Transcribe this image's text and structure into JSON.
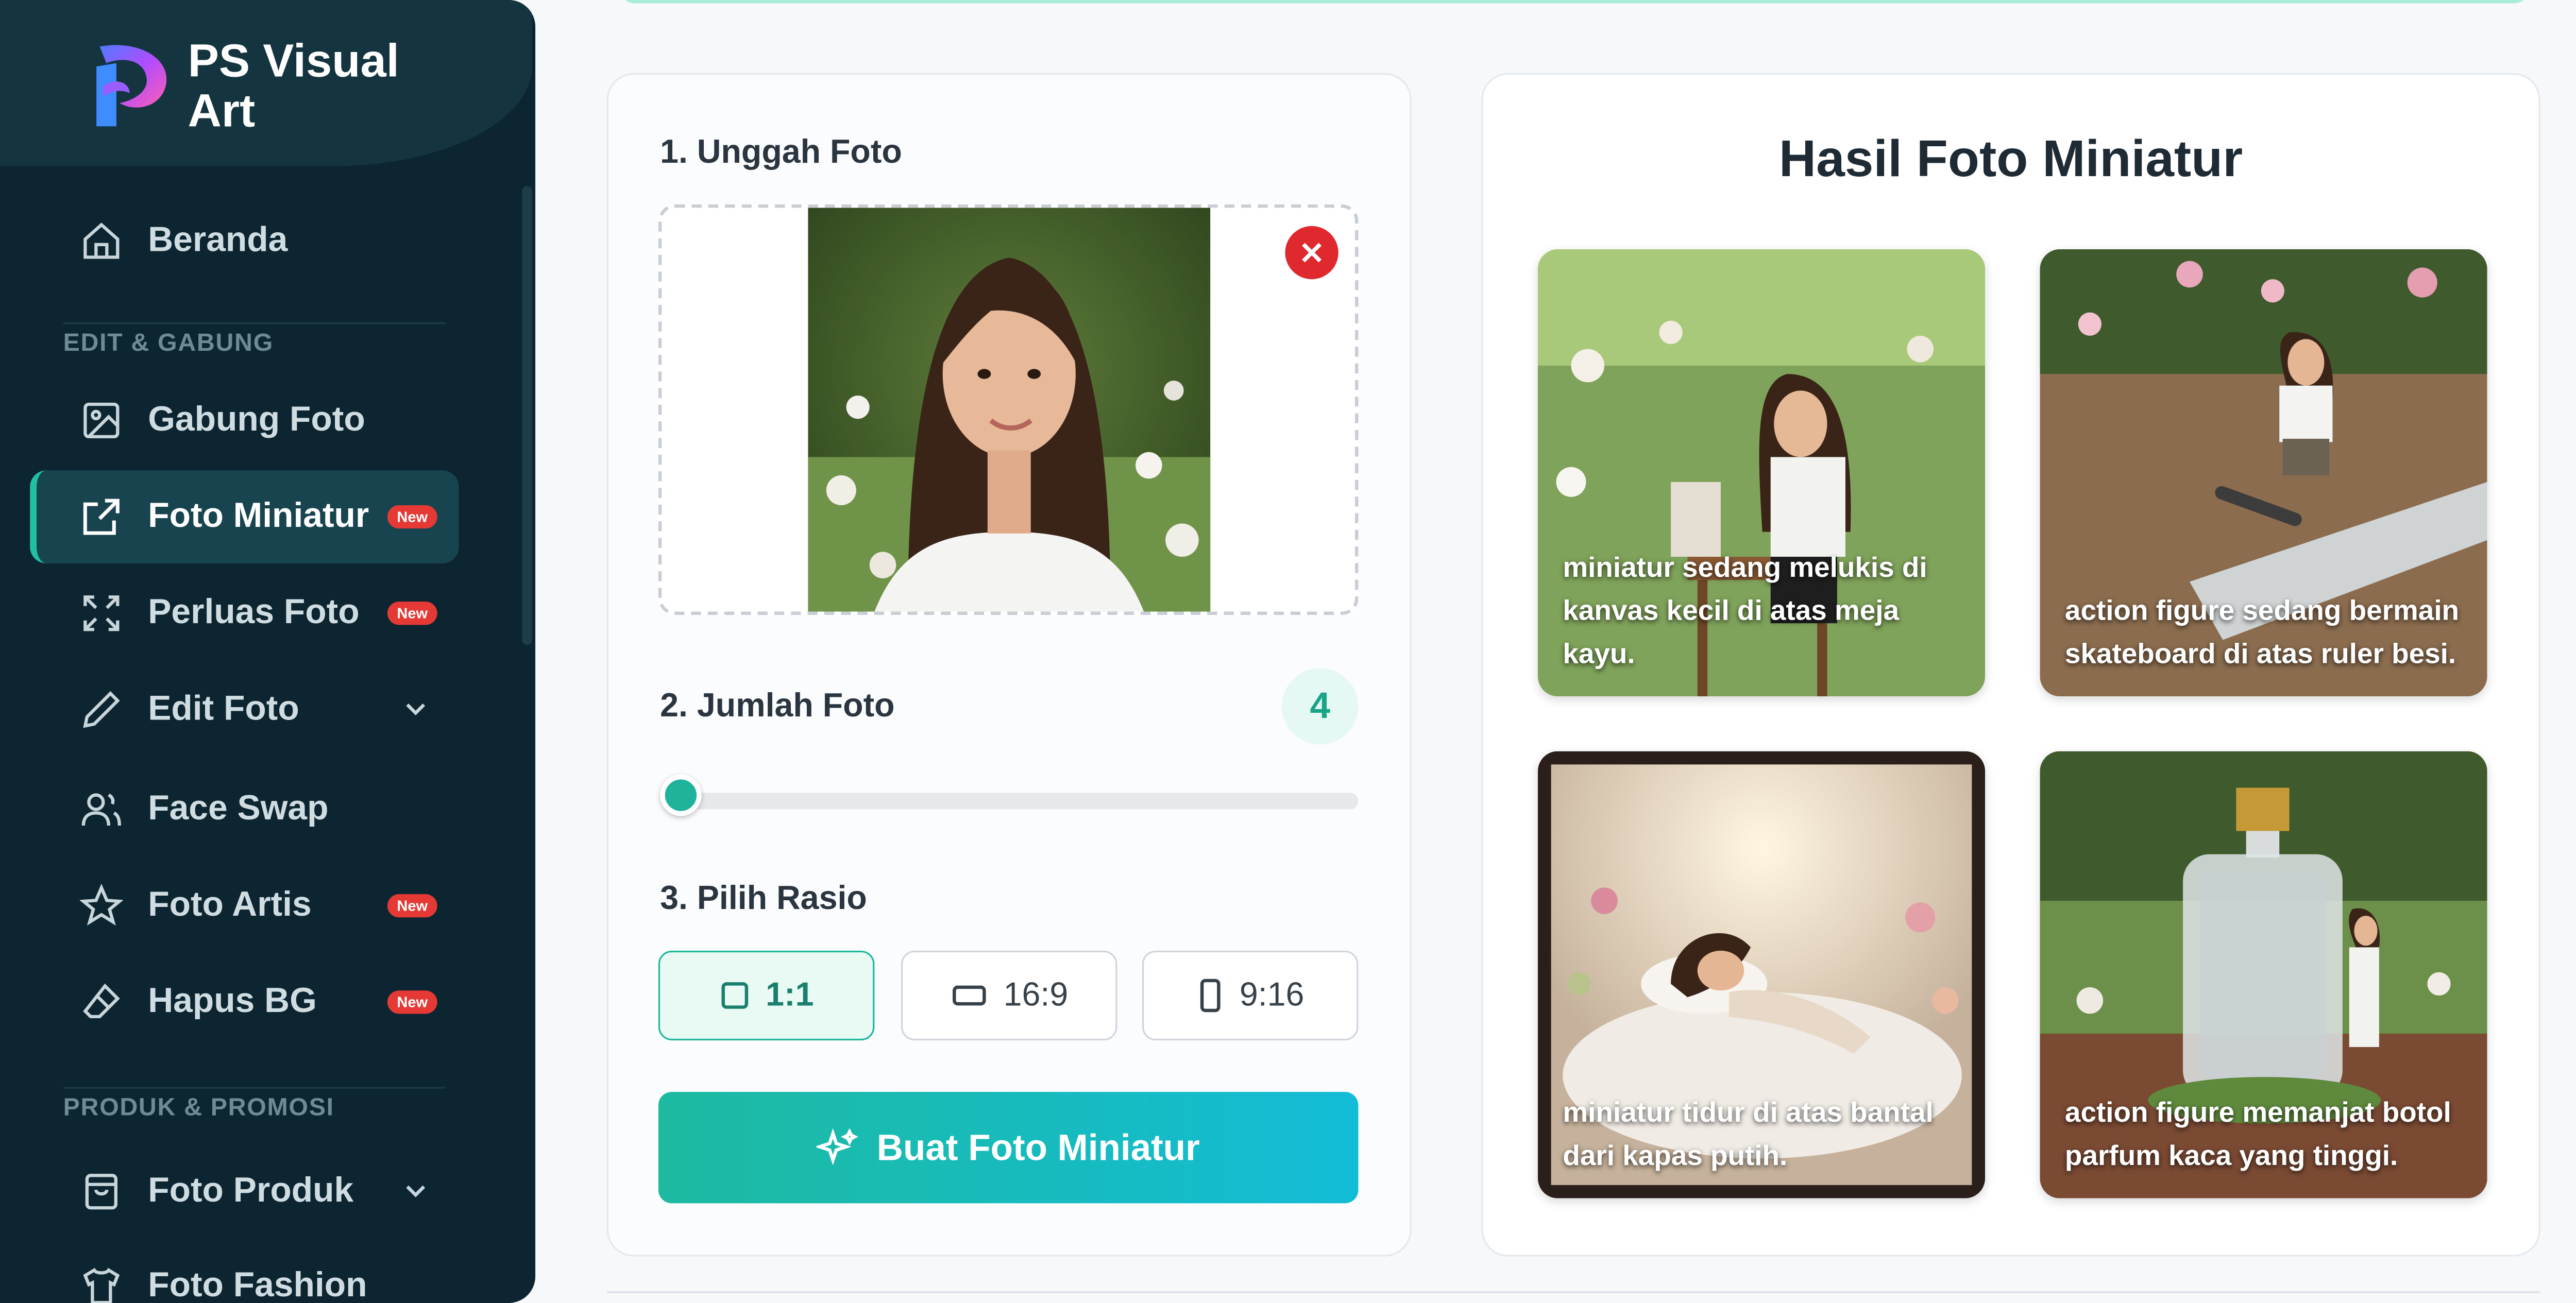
{
  "brand": {
    "name": "PS Visual Art"
  },
  "sidebar": {
    "items": [
      {
        "label": "Beranda",
        "icon": "home-icon"
      },
      {
        "label": "Gabung Foto",
        "icon": "image-icon"
      },
      {
        "label": "Foto Miniatur",
        "icon": "external-edit-icon",
        "badge": "New",
        "active": true
      },
      {
        "label": "Perluas Foto",
        "icon": "expand-icon",
        "badge": "New"
      },
      {
        "label": "Edit Foto",
        "icon": "pencil-icon"
      },
      {
        "label": "Face Swap",
        "icon": "users-icon"
      },
      {
        "label": "Foto Artis",
        "icon": "star-icon",
        "badge": "New"
      },
      {
        "label": "Hapus BG",
        "icon": "eraser-icon",
        "badge": "New"
      },
      {
        "label": "Foto Produk",
        "icon": "bag-icon"
      },
      {
        "label": "Foto Fashion",
        "icon": "shirt-icon"
      }
    ],
    "sections": {
      "edit": "EDIT & GABUNG",
      "produk": "PRODUK & PROMOSI"
    }
  },
  "form": {
    "upload_label": "1. Unggah Foto",
    "count_label": "2. Jumlah Foto",
    "count_value": "4",
    "slider_fraction": 0,
    "ratio_label": "3. Pilih Rasio",
    "ratios": [
      "1:1",
      "16:9",
      "9:16"
    ],
    "selected_ratio": "1:1",
    "generate_label": "Buat Foto Miniatur"
  },
  "results": {
    "title": "Hasil Foto Miniatur",
    "items": [
      {
        "caption": "miniatur sedang melukis di kanvas kecil di atas meja kayu."
      },
      {
        "caption": "action figure sedang bermain skateboard di atas ruler besi."
      },
      {
        "caption": "miniatur tidur di atas bantal dari kapas putih."
      },
      {
        "caption": "action figure memanjat botol parfum kaca yang tinggi."
      }
    ]
  },
  "colors": {
    "accent": "#1fb39c",
    "sidebar": "#0c2530",
    "badge": "#e53935",
    "remove": "#e0292e"
  }
}
